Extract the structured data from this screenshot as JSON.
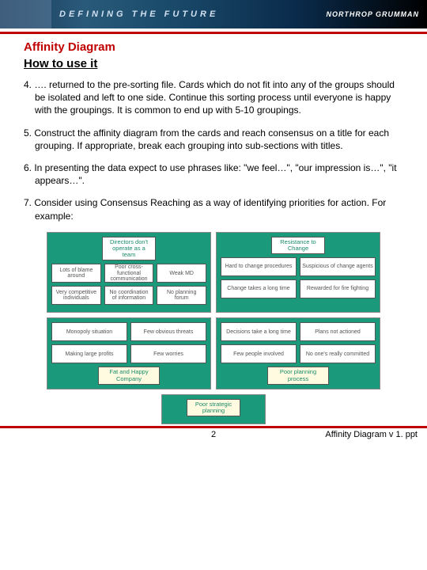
{
  "banner": {
    "defining": "DEFINING THE FUTURE",
    "logo": "NORTHROP GRUMMAN"
  },
  "headings": {
    "title": "Affinity Diagram",
    "subtitle": "How to use it"
  },
  "steps": {
    "s4": "4. …. returned to the pre-sorting file. Cards which do not fit into any of the groups should be isolated and left to one side. Continue this sorting process until everyone is happy with the groupings. It is common to end up with 5-10 groupings.",
    "s5": "5. Construct the affinity diagram from the cards and reach consensus on a title for each grouping. If appropriate, break each grouping into sub-sections with titles.",
    "s6": "6. In presenting the data expect to use phrases like: \"we feel…\", \"our impression is…\", \"it appears…\".",
    "s7": "7. Consider using Consensus Reaching as a way of identifying priorities for action. For example:"
  },
  "diagram": {
    "g1": {
      "title": "Directors don't operate as a team",
      "cards": [
        "Lots of blame around",
        "Poor cross-functional communication",
        "Weak MD",
        "Very competitive individuals",
        "No coordination of information",
        "No planning forum"
      ]
    },
    "g2": {
      "title": "Resistance to Change",
      "cards": [
        "Hard to change procedures",
        "Suspicious of change agents",
        "Change takes a long time",
        "Rewarded for fire fighting"
      ]
    },
    "g3": {
      "title": "Fat and Happy Company",
      "cards": [
        "Monopoly situation",
        "Few obvious threats",
        "Making large profits",
        "Few worries"
      ]
    },
    "g4": {
      "title": "Poor planning process",
      "cards": [
        "Decisions take a long time",
        "Plans not actioned",
        "Few people involved",
        "No one's really committed"
      ]
    },
    "bottom": {
      "title": "Poor strategic planning"
    }
  },
  "footer": {
    "page": "2",
    "filename": "Affinity Diagram v 1. ppt"
  }
}
